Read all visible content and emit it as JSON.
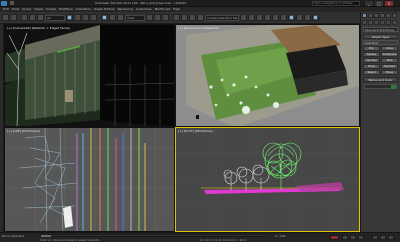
{
  "titlebar": {
    "title": "Autodesk 3ds Max 2011 x64 - Barn_and_trees.max - Untitled",
    "search_placeholder": "Type a keyword or phrase",
    "minimize": "_",
    "maximize": "□",
    "close": "×"
  },
  "menu": [
    "Edit",
    "Tools",
    "Group",
    "Views",
    "Create",
    "Modifiers",
    "Animation",
    "Graph Editors",
    "Rendering",
    "Customize",
    "MAXScript",
    "Help"
  ],
  "toolbar": {
    "selection_filter": "All",
    "reference_coord": "View",
    "named_selection": "Create Selection Set"
  },
  "viewports": {
    "top_left_label": "[+] [Camera02] [Realistic + Edged Faces]",
    "top_right_label": "[+] [Perspective] [Realistic]",
    "bottom_left_label": "[+] [Left] [Wireframe]",
    "bottom_right_label": "[+] [Front] [Wireframe]"
  },
  "command_panel": {
    "category": "Standard Primitives",
    "rollout_object_type": "Object Type",
    "autogrid": "AutoGrid",
    "objects": [
      "Box",
      "Cone",
      "Sphere",
      "GeoSphere",
      "Cylinder",
      "Tube",
      "Torus",
      "Pyramid",
      "Teapot",
      "Plane"
    ],
    "rollout_name_color": "Name and Color",
    "accent_color": "#2e7d32"
  },
  "statusbar": {
    "selection": "None Selected",
    "prompt": "Click or click-and-drag to select objects",
    "coords": "X: 0.0  Y: 0.0  Z: 0.0   Grid = 10.0",
    "frame": "0 / 100"
  }
}
